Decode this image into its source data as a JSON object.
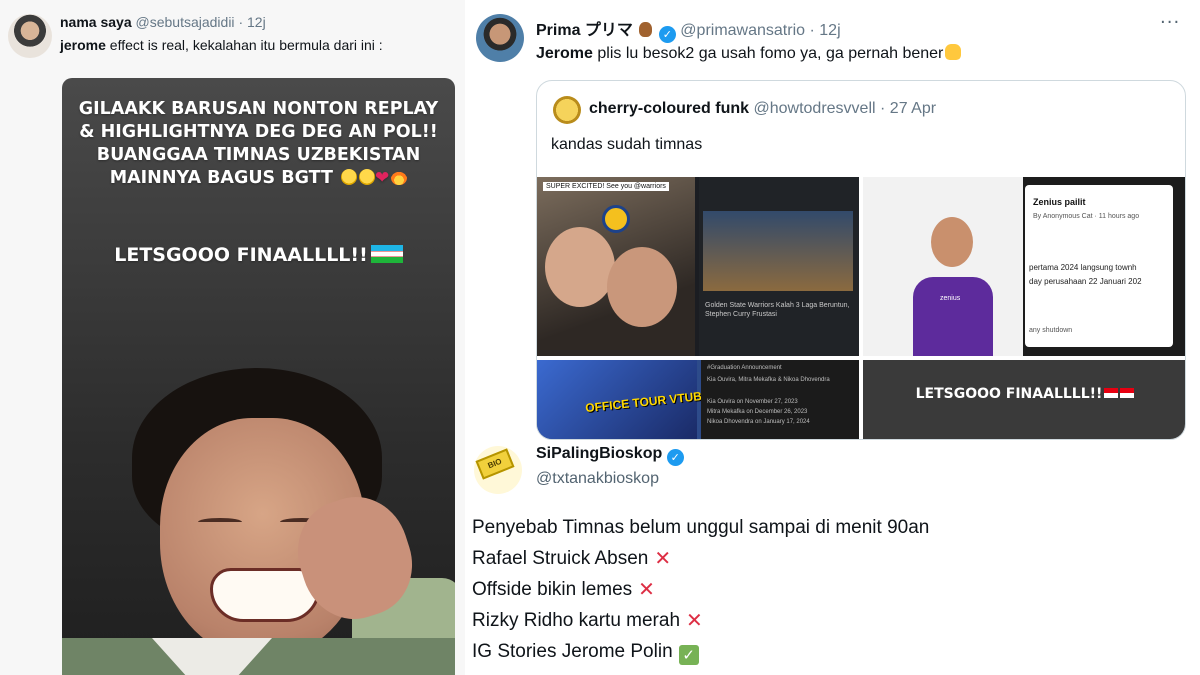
{
  "left_tweet": {
    "display_name": "nama saya",
    "handle": "@sebutsajadidii",
    "separator": "·",
    "time": "12j",
    "text_bold": "jerome",
    "text_rest": " effect is real, kekalahan itu bermula dari ini :",
    "story": {
      "line1": "GILAAKK BARUSAN NONTON REPLAY & HIGHLIGHTNYA DEG DEG AN POL!! BUANGGAA TIMNAS  UZBEKISTAN MAINNYA BAGUS BGTT",
      "line2": "LETSGOOO FINAALLLL!!",
      "flag_icon": "uzbekistan-flag-icon"
    }
  },
  "right_tweet": {
    "display_name": "Prima",
    "display_name_jp": "プリマ",
    "handle": "@primawansatrio",
    "separator": "·",
    "time": "12j",
    "more": "···",
    "text_bold": "Jerome",
    "text_rest": " plis lu besok2 ga usah fomo ya, ga pernah bener",
    "quote": {
      "display_name": "cherry-coloured funk",
      "handle": "@howtodresvvell",
      "separator": "·",
      "date": "27 Apr",
      "text": "kandas sudah timnas",
      "grid": {
        "c1_label": "SUPER EXCITED! See you @warriors",
        "c1_news": "Golden State Warriors Kalah 3 Laga Beruntun, Stephen Curry Frustasi",
        "c2_logo": "zenius",
        "c2_title": "Zenius pailit",
        "c2_meta": "By Anonymous Cat · 11 hours ago",
        "c2_line1": "pertama 2024 langsung townh",
        "c2_line2": "day perusahaan 22 Januari 202",
        "c2_footer": "any shutdown",
        "c3_banner": "OFFICE TOUR VTUBER!",
        "c3_lines": [
          "#Graduation Announcement",
          "Kia Ouvira, Mitra Mekafka & Nikoa Dhovendra",
          "Kia Ouvira on November 27, 2023",
          "Mitra Mekafka on December 26, 2023",
          "Nikoa Dhovendra on January 17, 2024"
        ],
        "c4_text": "LETSGOOO FINAALLLL!!"
      }
    }
  },
  "bottom_tweet": {
    "display_name": "SiPalingBioskop",
    "handle": "@txtanakbioskop",
    "ticket_label": "BIO",
    "lines": [
      "Penyebab Timnas belum unggul sampai di menit 90an",
      "Rafael Struick Absen",
      "Offside bikin lemes",
      "Rizky Ridho kartu merah",
      "IG Stories Jerome Polin"
    ],
    "marks": [
      "",
      "cross-mark-icon",
      "cross-mark-icon",
      "cross-mark-icon",
      "check-mark-icon"
    ]
  },
  "colors": {
    "accent": "#1d9bf0",
    "muted": "#536471",
    "cross": "#dd2e44",
    "check": "#77b255"
  }
}
